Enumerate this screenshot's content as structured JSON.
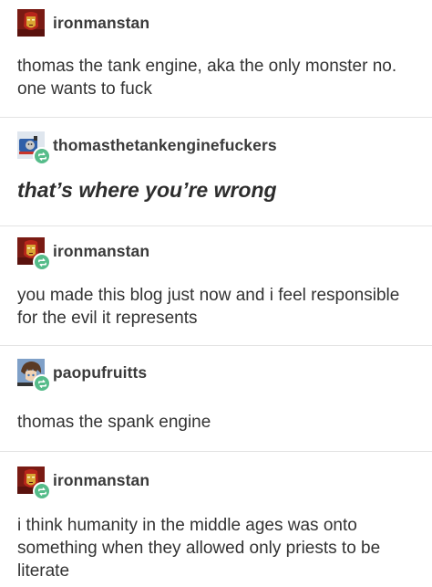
{
  "posts": [
    {
      "username": "ironmanstan",
      "text": "thomas the tank engine, aka the only monster no. one wants to fuck",
      "reblog": false
    },
    {
      "username": "thomasthetankenginefuckers",
      "text": "that’s where you’re wrong",
      "reblog": true
    },
    {
      "username": "ironmanstan",
      "text": "you made this blog just now and i feel responsible for the evil it represents",
      "reblog": true
    },
    {
      "username": "paopufruitts",
      "text": "thomas the spank engine",
      "reblog": true
    },
    {
      "username": "ironmanstan",
      "text": "i think humanity in the middle ages was onto something when they allowed only priests to be literate",
      "reblog": true
    }
  ],
  "icons": {
    "reblog_badge": "reblog-icon",
    "avatar_ironman": "ironman-avatar",
    "avatar_thomas": "thomas-train-avatar",
    "avatar_paopu": "anime-boy-avatar"
  },
  "colors": {
    "reblog_badge": "#56bc8a",
    "divider": "#e3e3e3",
    "text": "#333333"
  }
}
